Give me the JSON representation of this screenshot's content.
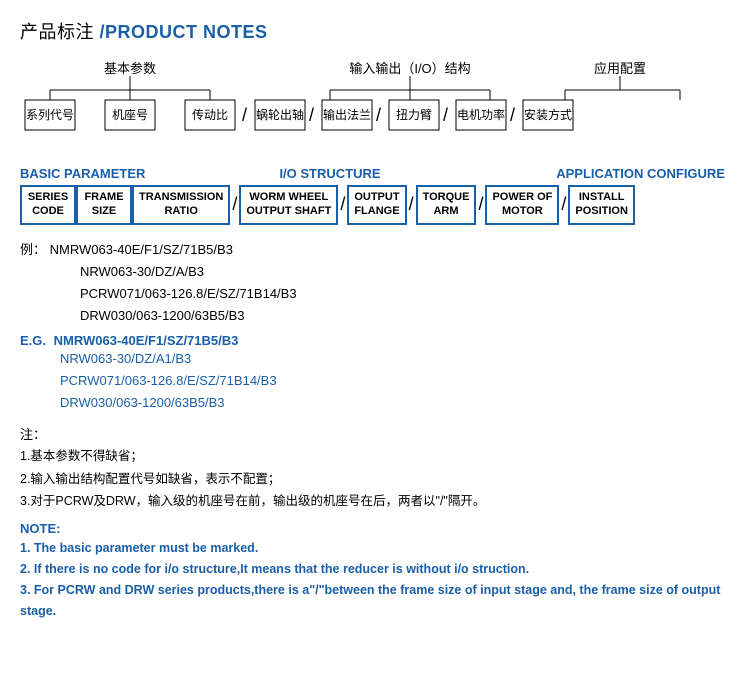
{
  "page": {
    "title_cn": "产品标注",
    "title_en": "/PRODUCT NOTES",
    "cn_diagram": {
      "group_basic": "基本参数",
      "group_io": "输入输出（I/O）结构",
      "group_app": "应用配置",
      "boxes": [
        "系列代号",
        "机座号",
        "传动比",
        "蜗轮出轴",
        "输出法兰",
        "扭力臂",
        "电机功率",
        "安装方式"
      ]
    },
    "en_diagram": {
      "label_basic": "BASIC PARAMETER",
      "label_io": "I/O STRUCTURE",
      "label_app": "APPLICATION CONFIGURE",
      "boxes": [
        {
          "text": "SERIES\nCODE"
        },
        {
          "text": "FRAME\nSIZE"
        },
        {
          "text": "TRANSMISSION\nRATIO"
        },
        {
          "text": "WORM WHEEL\nOUTPUT SHAFT"
        },
        {
          "text": "OUTPUT\nFLANGE"
        },
        {
          "text": "TORQUE\nARM"
        },
        {
          "text": "POWER OF\nMOTOR"
        },
        {
          "text": "INSTALL\nPOSITION"
        }
      ]
    },
    "examples_cn": {
      "label": "例：",
      "lines": [
        "NMRW063-40E/F1/SZ/71B5/B3",
        "NRW063-30/DZ/A/B3",
        "PCRW071/063-126.8/E/SZ/71B14/B3",
        "DRW030/063-1200/63B5/B3"
      ]
    },
    "examples_en": {
      "label": "E.G.",
      "lines": [
        "NMRW063-40E/F1/SZ/71B5/B3",
        "NRW063-30/DZ/A1/B3",
        "PCRW071/063-126.8/E/SZ/71B14/B3",
        "DRW030/063-1200/63B5/B3"
      ]
    },
    "notes_cn": {
      "title": "注：",
      "lines": [
        "1.基本参数不得缺省；",
        "2.输入输出结构配置代号如缺省，表示不配置；",
        "3.对于PCRW及DRW，输入级的机座号在前，输出级的机座号在后，两者以\"/\"隔开。"
      ]
    },
    "notes_en": {
      "title": "NOTE:",
      "lines": [
        "1. The basic parameter must be marked.",
        "2. If there is no code for i/o structure,It  means that the reducer is without i/o struction.",
        "3. For PCRW and DRW series products,there is a\"/\"between the frame size of input stage and,  the frame size of output stage."
      ]
    }
  }
}
